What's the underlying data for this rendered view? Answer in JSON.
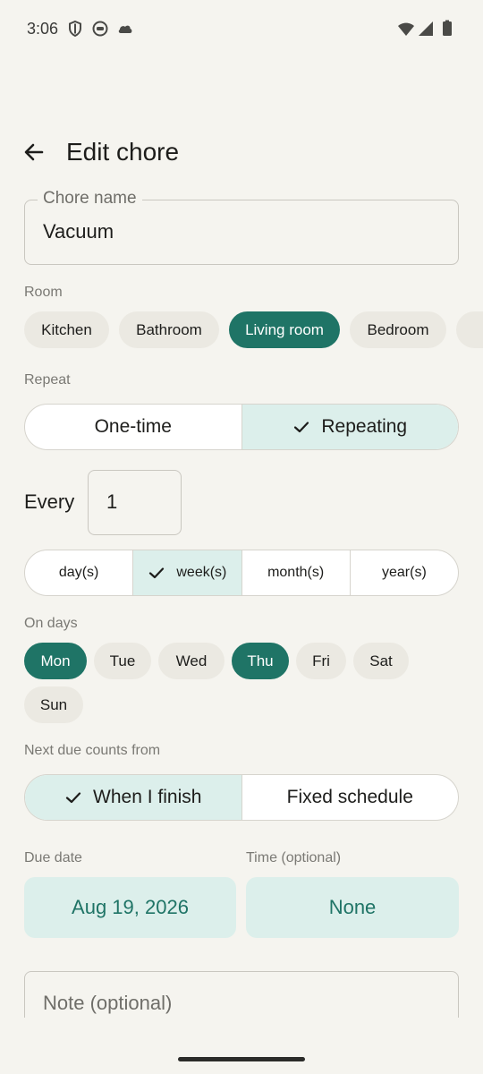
{
  "status": {
    "time": "3:06",
    "left_icons": [
      "shield-icon",
      "face-icon",
      "cloud-icon"
    ],
    "right_icons": [
      "wifi-icon",
      "signal-icon",
      "battery-icon"
    ]
  },
  "header": {
    "title": "Edit chore",
    "back_icon": "arrow-back-icon"
  },
  "chore_name": {
    "label": "Chore name",
    "value": "Vacuum"
  },
  "room": {
    "label": "Room",
    "options": [
      {
        "label": "Kitchen",
        "selected": false
      },
      {
        "label": "Bathroom",
        "selected": false
      },
      {
        "label": "Living room",
        "selected": true
      },
      {
        "label": "Bedroom",
        "selected": false
      }
    ]
  },
  "repeat": {
    "label": "Repeat",
    "options": [
      {
        "label": "One-time",
        "selected": false
      },
      {
        "label": "Repeating",
        "selected": true
      }
    ]
  },
  "every": {
    "label": "Every",
    "value": "1"
  },
  "units": {
    "options": [
      {
        "label": "day(s)",
        "selected": false
      },
      {
        "label": "week(s)",
        "selected": true
      },
      {
        "label": "month(s)",
        "selected": false
      },
      {
        "label": "year(s)",
        "selected": false
      }
    ]
  },
  "days": {
    "label": "On days",
    "options": [
      {
        "label": "Mon",
        "selected": true
      },
      {
        "label": "Tue",
        "selected": false
      },
      {
        "label": "Wed",
        "selected": false
      },
      {
        "label": "Thu",
        "selected": true
      },
      {
        "label": "Fri",
        "selected": false
      },
      {
        "label": "Sat",
        "selected": false
      },
      {
        "label": "Sun",
        "selected": false
      }
    ]
  },
  "next_due": {
    "label": "Next due counts from",
    "options": [
      {
        "label": "When I finish",
        "selected": true
      },
      {
        "label": "Fixed schedule",
        "selected": false
      }
    ]
  },
  "due_date": {
    "label": "Due date",
    "value": "Aug 19, 2026"
  },
  "time": {
    "label": "Time (optional)",
    "value": "None"
  },
  "note": {
    "placeholder": "Note (optional)"
  },
  "colors": {
    "accent": "#1f7466",
    "accent_light": "#dcefeb",
    "background": "#f5f4ef",
    "chip": "#ebe9e2"
  }
}
